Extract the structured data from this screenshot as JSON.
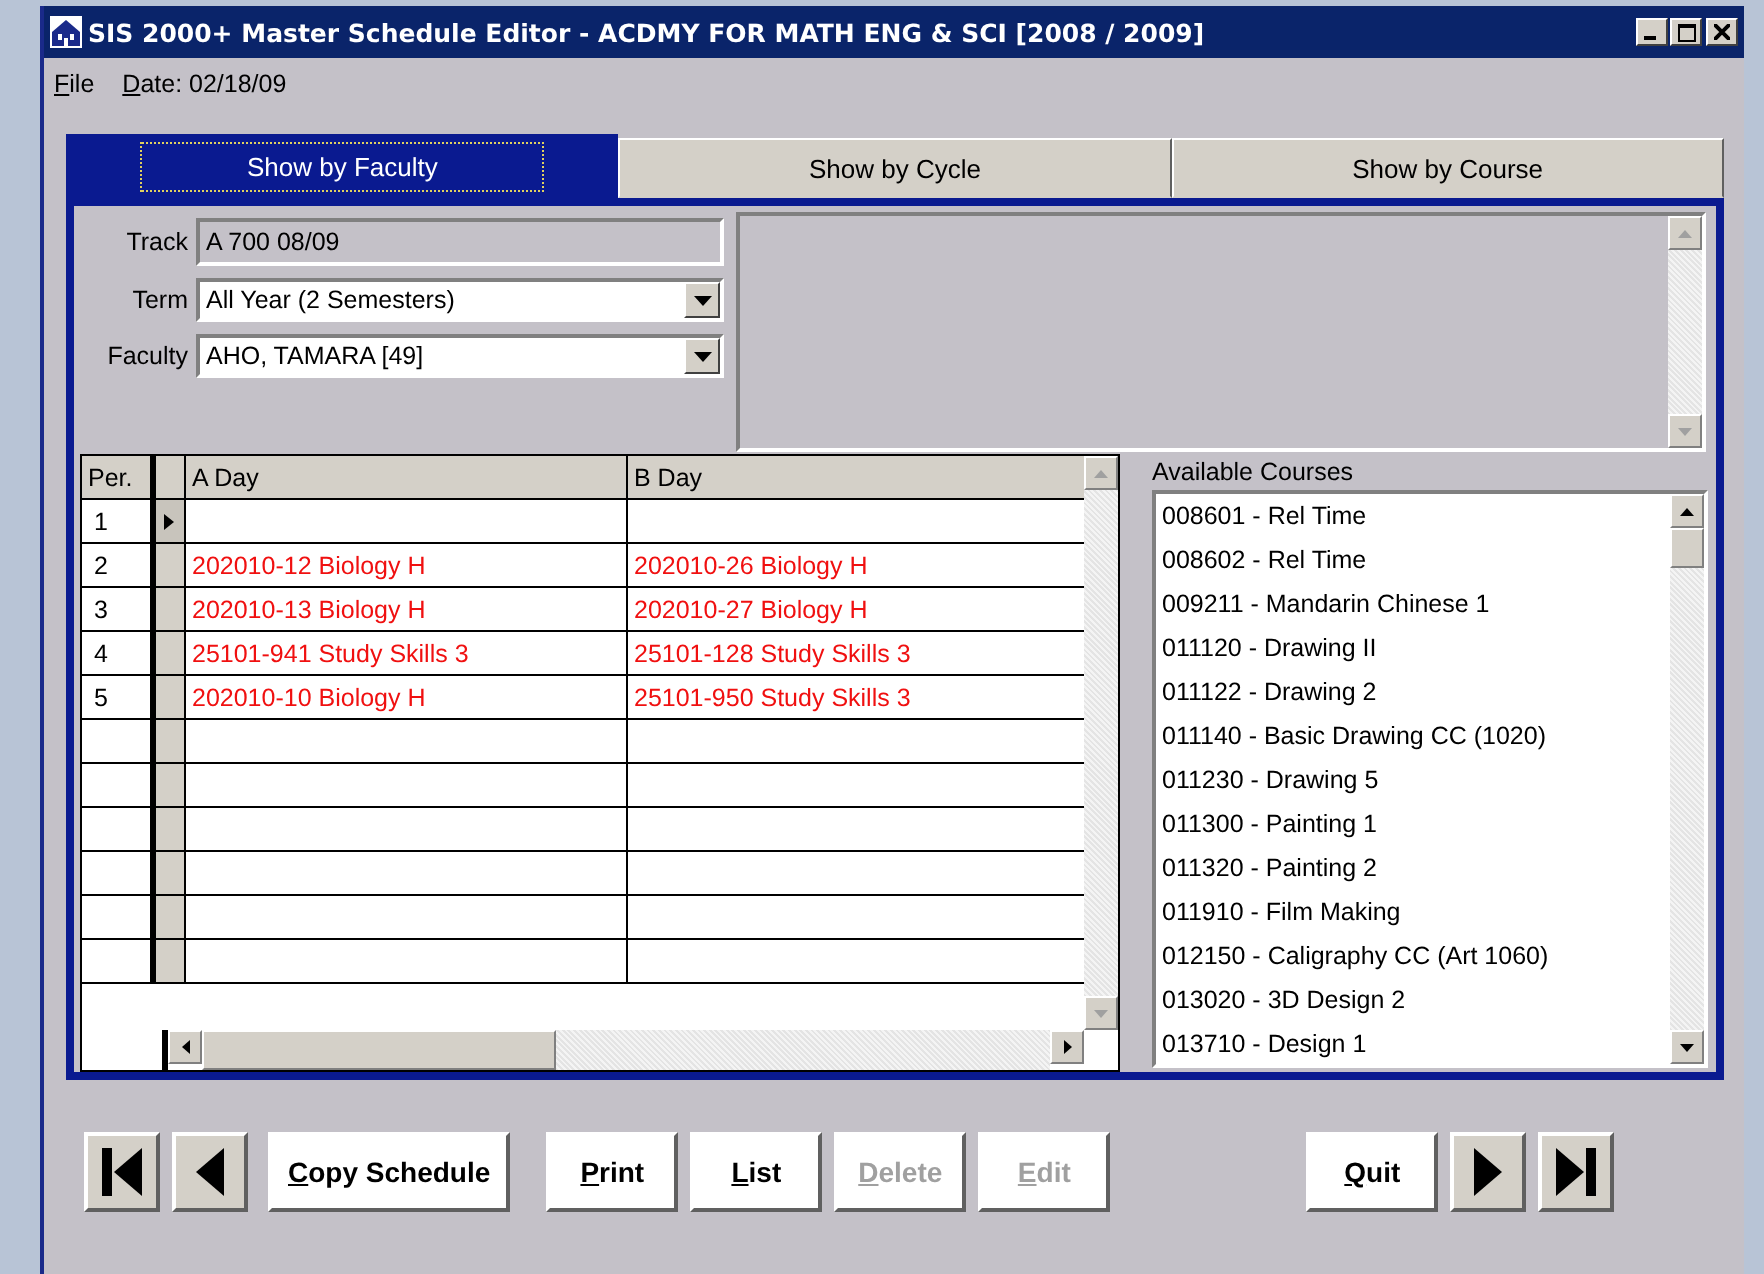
{
  "window": {
    "title": "SIS 2000+   Master Schedule Editor - ACDMY FOR MATH ENG & SCI [2008 / 2009]"
  },
  "menu": [
    "File",
    "Date: 02/18/09"
  ],
  "tabs": [
    {
      "label": "Show by Faculty",
      "selected": true
    },
    {
      "label": "Show by Cycle",
      "selected": false
    },
    {
      "label": "Show by Course",
      "selected": false
    }
  ],
  "fields": [
    {
      "label": "Track",
      "value": "A 700 08/09",
      "kind": "readonly"
    },
    {
      "label": "Term",
      "value": "All Year (2 Semesters)",
      "kind": "dropdown"
    },
    {
      "label": "Faculty",
      "value": "AHO, TAMARA [49]",
      "kind": "dropdown"
    }
  ],
  "grid": {
    "columns": [
      "Per.",
      "A Day",
      "B Day"
    ],
    "rows": [
      {
        "per": "1",
        "current": true
      },
      {
        "per": "2",
        "current": false,
        "a_day": "202010-12  Biology H",
        "b_day": "202010-26  Biology H"
      },
      {
        "per": "3",
        "current": false,
        "a_day": "202010-13  Biology H",
        "b_day": "202010-27  Biology H"
      },
      {
        "per": "4",
        "current": false,
        "a_day": "25101-941  Study Skills 3",
        "b_day": "25101-128  Study Skills 3"
      },
      {
        "per": "5",
        "current": false,
        "a_day": "202010-10  Biology H",
        "b_day": "25101-950  Study Skills 3"
      }
    ]
  },
  "available_courses": {
    "label": "Available Courses",
    "items": [
      "008601 - Rel Time",
      "008602 - Rel Time",
      "009211 - Mandarin Chinese 1",
      "011120 - Drawing II",
      "011122 - Drawing 2",
      "011140 - Basic Drawing CC (1020)",
      "011230 - Drawing 5",
      "011300 - Painting 1",
      "011320 - Painting 2",
      "011910 - Film Making",
      "012150 - Caligraphy CC (Art 1060)",
      "013020 - 3D Design 2",
      "013710 - Design 1"
    ]
  },
  "buttons": [
    {
      "label": "Copy Schedule",
      "disabled": false
    },
    {
      "label": "Print",
      "disabled": false
    },
    {
      "label": "List",
      "disabled": false
    },
    {
      "label": "Delete",
      "disabled": true
    },
    {
      "label": "Edit",
      "disabled": true
    },
    {
      "label": "Quit",
      "disabled": false
    }
  ]
}
